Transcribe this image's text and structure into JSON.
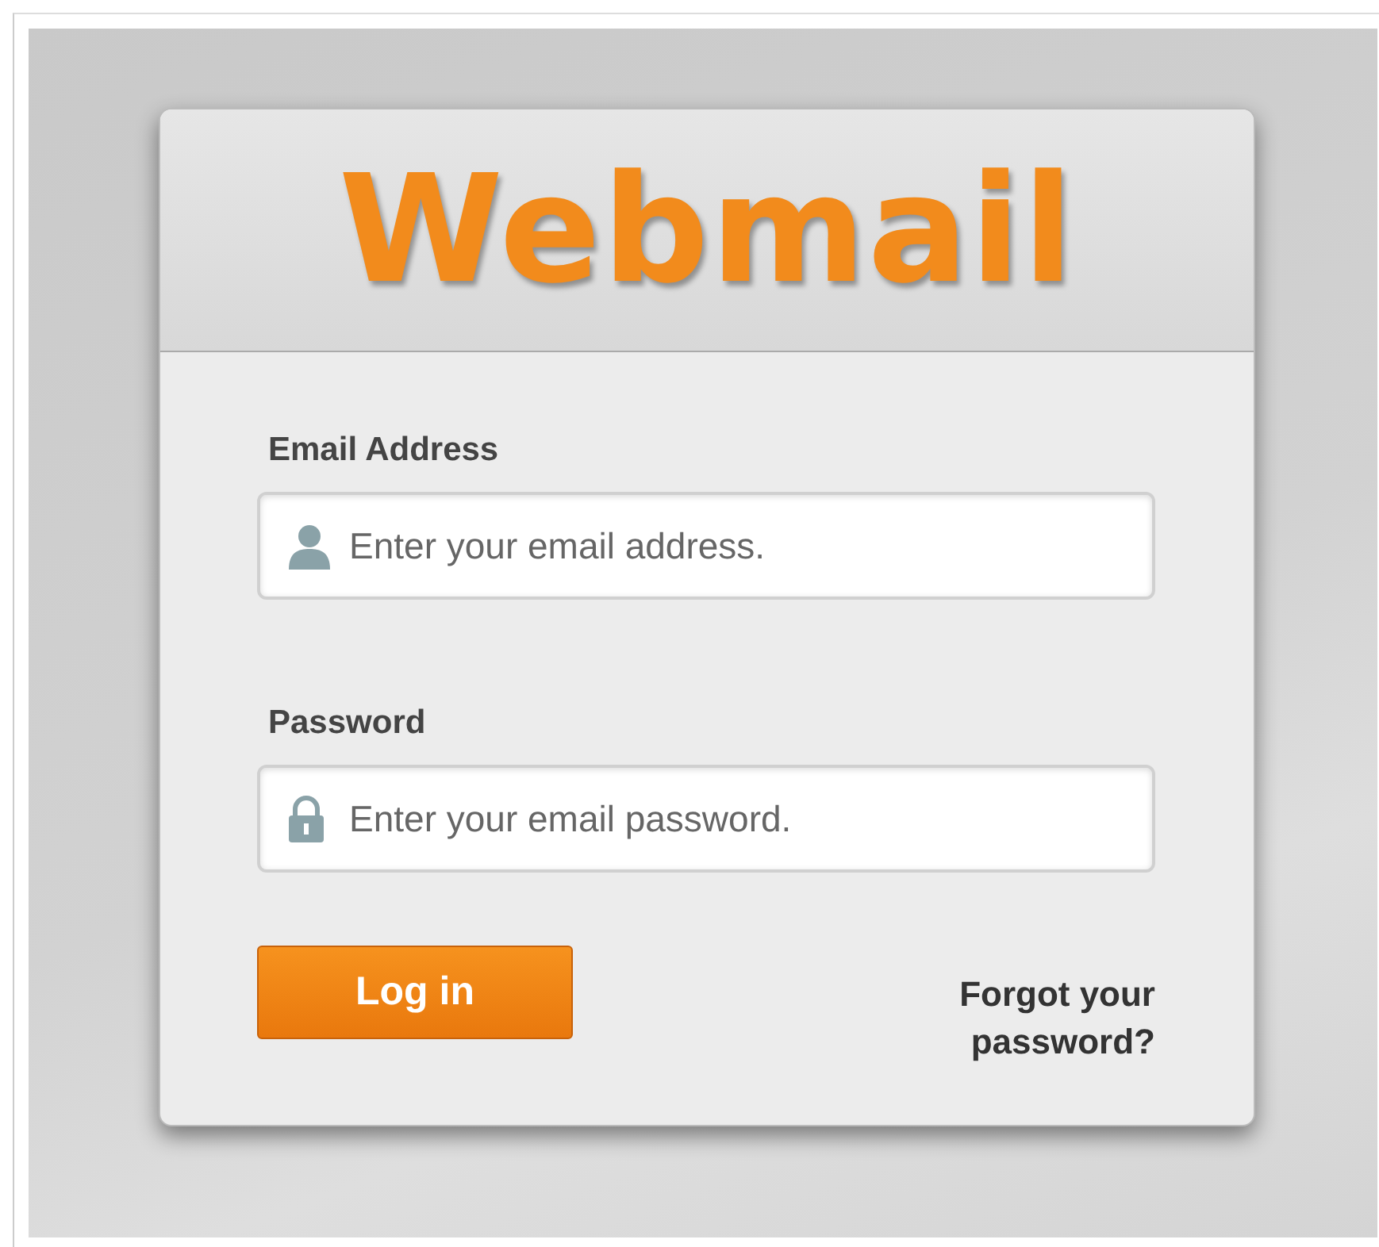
{
  "logo": {
    "text": "Webmail"
  },
  "fields": [
    {
      "kind": "email",
      "label": "Email Address",
      "placeholder": "Enter your email address."
    },
    {
      "kind": "password",
      "label": "Password",
      "placeholder": "Enter your email password."
    }
  ],
  "login_button": "Log in",
  "forgot_link": "Forgot your password?"
}
